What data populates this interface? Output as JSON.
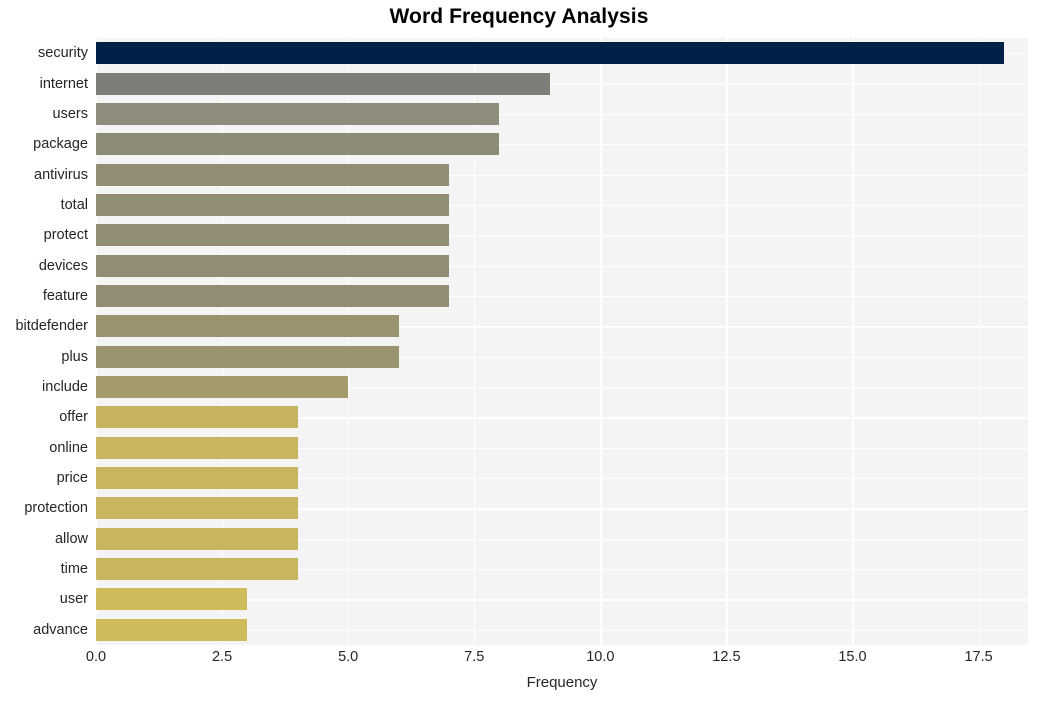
{
  "chart_data": {
    "type": "bar",
    "orientation": "horizontal",
    "title": "Word Frequency Analysis",
    "xlabel": "Frequency",
    "ylabel": "",
    "categories": [
      "security",
      "internet",
      "users",
      "package",
      "antivirus",
      "total",
      "protect",
      "devices",
      "feature",
      "bitdefender",
      "plus",
      "include",
      "offer",
      "online",
      "price",
      "protection",
      "allow",
      "time",
      "user",
      "advance"
    ],
    "values": [
      18,
      9,
      8,
      8,
      7,
      7,
      7,
      7,
      7,
      6,
      6,
      5,
      4,
      4,
      4,
      4,
      4,
      4,
      3,
      3
    ],
    "bar_colors": [
      "#002147",
      "#7f7d78",
      "#918d7c",
      "#8f8b79",
      "#928e76",
      "#928e76",
      "#928e76",
      "#928e76",
      "#928e76",
      "#9a9370",
      "#9a9370",
      "#a49a6b",
      "#c6b35f",
      "#c8b55f",
      "#c8b55f",
      "#c8b55f",
      "#c8b55f",
      "#c8b55f",
      "#d0bb5b",
      "#d0bb5b"
    ],
    "xlim": [
      0,
      18.48
    ],
    "xticks": [
      0,
      2.5,
      5,
      7.5,
      10,
      12.5,
      15,
      17.5
    ],
    "xtick_labels": [
      "0.0",
      "2.5",
      "5.0",
      "7.5",
      "10.0",
      "12.5",
      "15.0",
      "17.5"
    ],
    "grid": true,
    "grid_color": "#ffffff",
    "plot_background": "#f4f4f5",
    "figure_background": "#ffffff",
    "legend": null
  }
}
